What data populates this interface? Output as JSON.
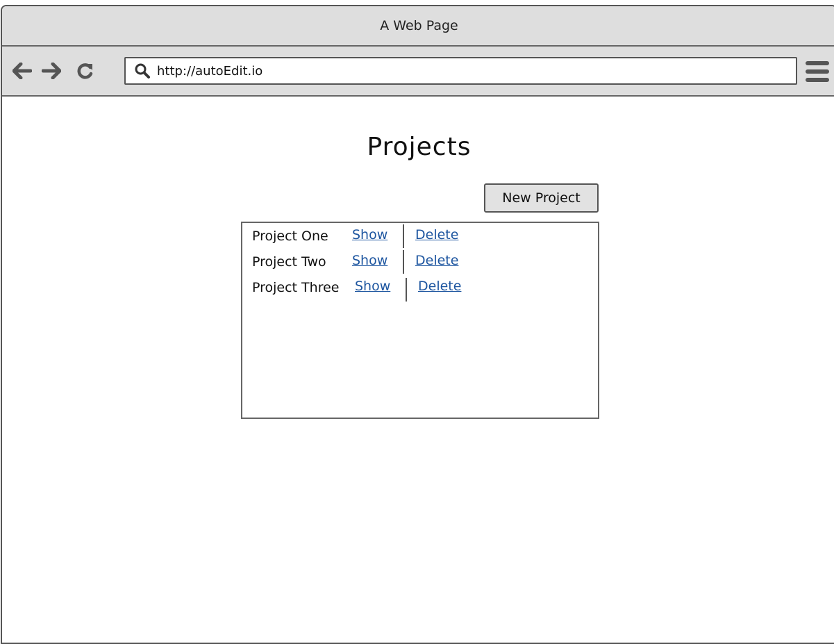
{
  "window": {
    "title": "A Web Page"
  },
  "toolbar": {
    "back_icon": "arrow-left-icon",
    "forward_icon": "arrow-right-icon",
    "reload_icon": "reload-icon",
    "search_icon": "search-icon",
    "menu_icon": "hamburger-menu-icon",
    "url": "http://autoEdit.io"
  },
  "page": {
    "title": "Projects",
    "new_button_label": "New Project",
    "projects": [
      {
        "name": "Project One",
        "show_label": "Show",
        "delete_label": "Delete"
      },
      {
        "name": "Project Two",
        "show_label": "Show",
        "delete_label": "Delete"
      },
      {
        "name": "Project Three",
        "show_label": "Show",
        "delete_label": "Delete"
      }
    ]
  },
  "colors": {
    "chrome": "#dedede",
    "link": "#1e56a0",
    "border": "#555555"
  }
}
